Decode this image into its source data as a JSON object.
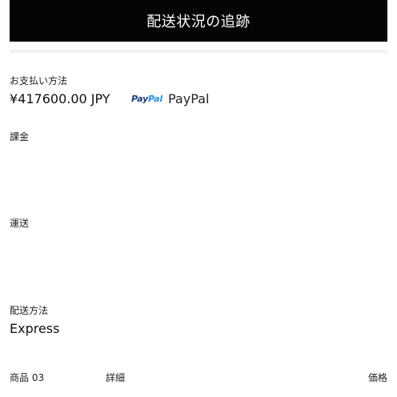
{
  "header": {
    "title": "配送状況の追跡"
  },
  "payment": {
    "label": "お支払い方法",
    "amount": "¥417600.00 JPY",
    "logo_text_pay": "Pay",
    "logo_text_pal": "Pal",
    "method_name": "PayPal"
  },
  "billing": {
    "label": "課金"
  },
  "shipping": {
    "label": "運送"
  },
  "delivery": {
    "label": "配送方法",
    "value": "Express"
  },
  "items_header": {
    "product": "商品 03",
    "detail": "詳細",
    "price": "価格"
  },
  "colors": {
    "header_bg": "#050505",
    "paypal_dark": "#1f3c7a",
    "paypal_light": "#2a8fd8"
  },
  "icons": {
    "payment_logo": "paypal-logo"
  }
}
